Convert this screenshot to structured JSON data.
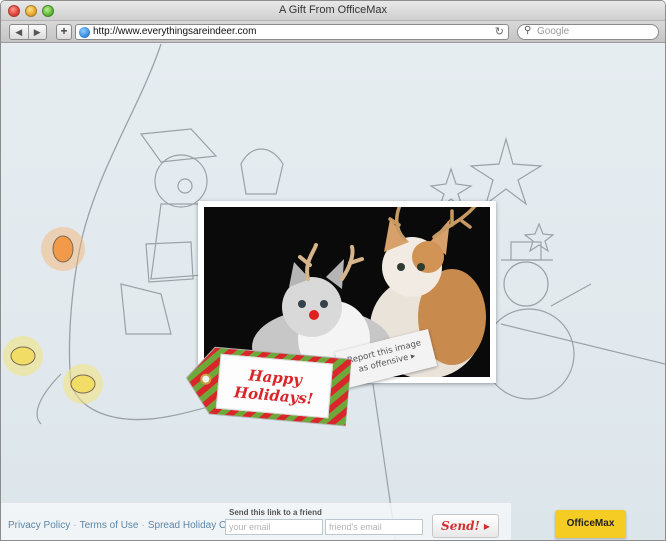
{
  "window": {
    "title": "A Gift From OfficeMax"
  },
  "toolbar": {
    "back_icon": "◀",
    "forward_icon": "▶",
    "add_icon": "+",
    "url": "http://www.everythingsareindeer.com",
    "reload_icon": "↻",
    "search_placeholder": "Google",
    "search_icon": "⚲"
  },
  "content": {
    "tag_text_line1": "Happy",
    "tag_text_line2": "Holidays!",
    "report_line1": "Report this image",
    "report_line2": "as offensive ▸"
  },
  "footer": {
    "links": [
      "Privacy Policy",
      "Terms of Use",
      "Spread Holiday Cheer:"
    ],
    "separator": "·",
    "send_label": "Send this link to a friend",
    "your_email_placeholder": "your email",
    "friend_email_placeholder": "friend's email",
    "send_button": "Send! ▸",
    "brand": "OfficeMax"
  },
  "colors": {
    "link": "#5b87a6",
    "tag_red": "#d9262b",
    "tag_green": "#6fa83a",
    "brand_yellow": "#f4cc23"
  }
}
